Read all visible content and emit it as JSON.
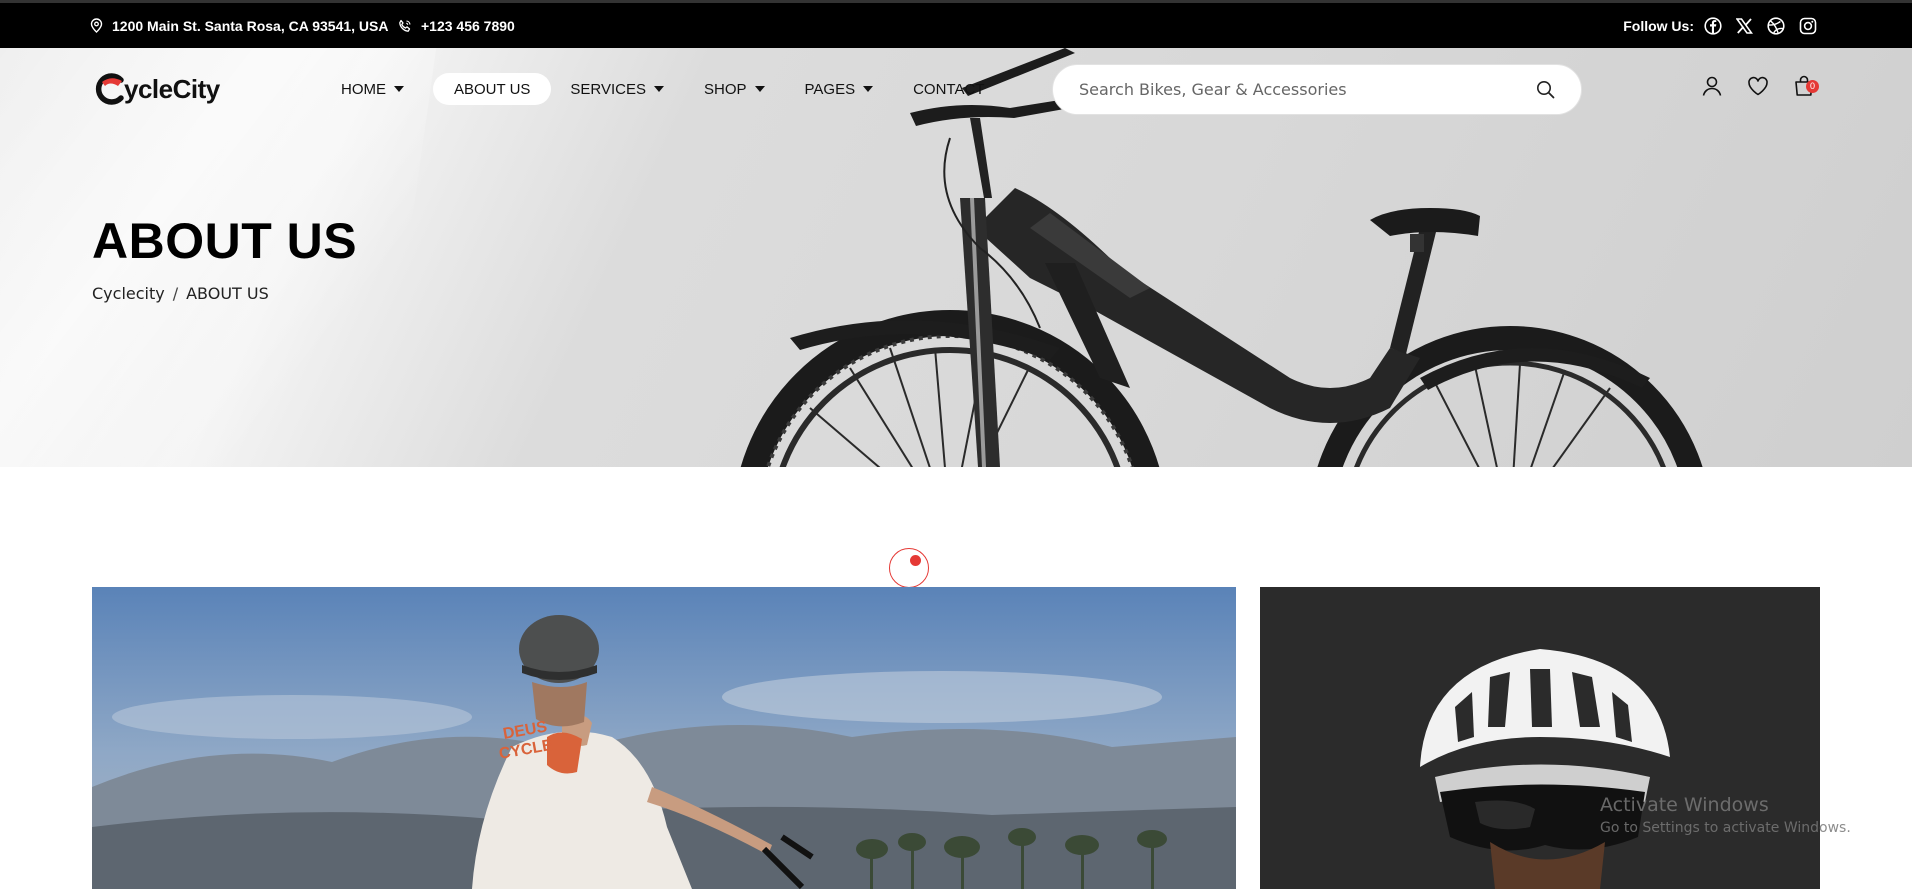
{
  "topbar": {
    "address": "1200 Main St. Santa Rosa, CA 93541, USA",
    "phone": "+123 456 7890",
    "follow_label": "Follow Us:",
    "socials": [
      "facebook-icon",
      "x-icon",
      "dribbble-icon",
      "instagram-icon"
    ]
  },
  "header": {
    "logo_text": "ycleCity",
    "nav": [
      {
        "label": "HOME",
        "has_dropdown": true
      },
      {
        "label": "ABOUT US",
        "active": true
      },
      {
        "label": "SERVICES",
        "has_dropdown": true
      },
      {
        "label": "SHOP",
        "has_dropdown": true
      },
      {
        "label": "PAGES",
        "has_dropdown": true
      },
      {
        "label": "CONTACT"
      }
    ],
    "search_placeholder": "Search Bikes, Gear & Accessories",
    "cart_count": "0"
  },
  "hero": {
    "title": "ABOUT US",
    "breadcrumb": [
      "Cyclecity",
      "/",
      "ABOUT US"
    ]
  },
  "watermark": {
    "line1": "Activate Windows",
    "line2": "Go to Settings to activate Windows."
  },
  "colors": {
    "accent": "#e53935",
    "topbar_bg": "#000000"
  }
}
